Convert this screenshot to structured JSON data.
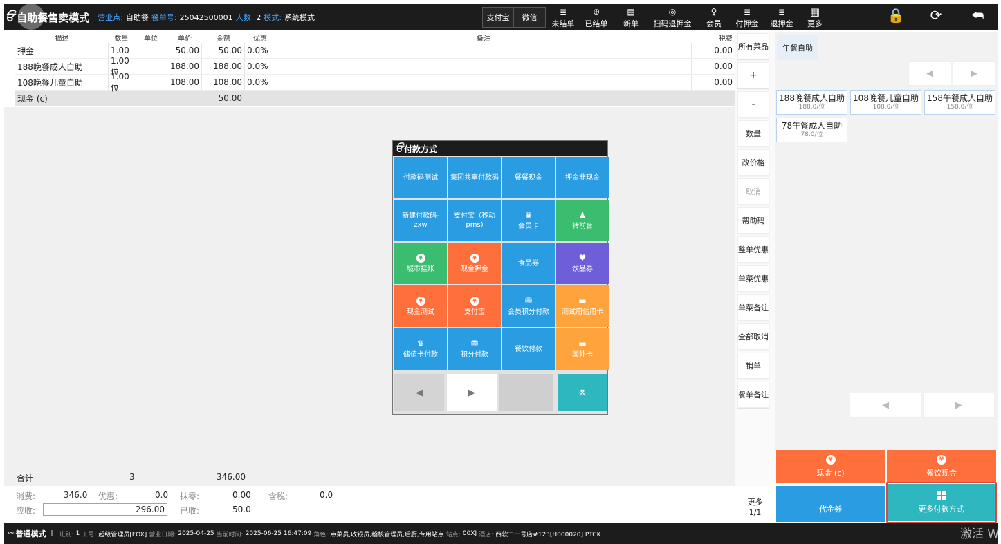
{
  "topbar": {
    "logo": "ਓਂ",
    "mode": "自助餐售卖模式",
    "outlet_label": "营业点:",
    "outlet": "自助餐",
    "order_label": "餐单号:",
    "order_no": "25042500001",
    "people_label": "人数:",
    "people": "2",
    "sysmode_label": "模式:",
    "sysmode": "系统模式",
    "pay_alipay": "支付宝",
    "pay_wechat": "微信",
    "buttons": [
      {
        "label": "未结单",
        "icon": "≣"
      },
      {
        "label": "已结单",
        "icon": "⊕"
      },
      {
        "label": "新单",
        "icon": "▤"
      },
      {
        "label": "扫码退押金",
        "icon": "◎"
      },
      {
        "label": "会员",
        "icon": "♀"
      },
      {
        "label": "付押金",
        "icon": "≣"
      },
      {
        "label": "退押金",
        "icon": "≣"
      },
      {
        "label": "更多",
        "icon": "▦"
      }
    ],
    "right_icons": [
      "lock-icon",
      "refresh-icon",
      "back-icon"
    ]
  },
  "table": {
    "headers": [
      "描述",
      "数量",
      "单位",
      "单价",
      "金额",
      "优惠",
      "备注",
      "税费"
    ],
    "rows": [
      {
        "name": "押金",
        "qty": "1.00",
        "unit": "",
        "price": "50.00",
        "amount": "50.00",
        "discount": "0.0%",
        "note": "",
        "tax": "0.00"
      },
      {
        "name": "188晚餐成人自助",
        "qty": "1.00位",
        "unit": "",
        "price": "188.00",
        "amount": "188.00",
        "discount": "0.0%",
        "note": "",
        "tax": "0.00"
      },
      {
        "name": "108晚餐儿童自助",
        "qty": "1.00位",
        "unit": "",
        "price": "108.00",
        "amount": "108.00",
        "discount": "0.0%",
        "note": "",
        "tax": "0.00"
      }
    ],
    "payment_row": {
      "name": "现金 (c)",
      "amount": "50.00"
    }
  },
  "totals": {
    "label": "合计",
    "count": "3",
    "amount": "346.00"
  },
  "summary": {
    "consume_label": "消费:",
    "consume": "346.0",
    "discount_label": "优惠:",
    "discount": "0.0",
    "rounding_label": "抹零:",
    "rounding": "0.00",
    "tax_label": "含税:",
    "tax": "0.0",
    "due_label": "应收:",
    "due": "296.00",
    "received_label": "已收:",
    "received": "50.0"
  },
  "functions": [
    "所有菜品",
    "+",
    "-",
    "数量",
    "改价格",
    "取消",
    "帮助码",
    "整单优惠",
    "单菜优惠",
    "单菜备注",
    "全部取消",
    "销单",
    "餐单备注"
  ],
  "more_page": {
    "label": "更多",
    "page": "1/1"
  },
  "dish": {
    "category": "午餐自助",
    "items": [
      {
        "name": "188晚餐成人自助",
        "price": "188.0/位"
      },
      {
        "name": "108晚餐儿童自助",
        "price": "108.0/位"
      },
      {
        "name": "158午餐成人自助",
        "price": "158.0/位"
      },
      {
        "name": "78午餐成人自助",
        "price": "78.0/位"
      }
    ]
  },
  "pay_tiles": [
    {
      "label": "现金 (c)",
      "color": "#ff6f3c"
    },
    {
      "label": "餐饮现金",
      "color": "#ff6f3c"
    },
    {
      "label": "代金券",
      "color": "#2a9de2"
    },
    {
      "label": "更多付款方式",
      "color": "#2fb7c0"
    }
  ],
  "modal": {
    "title": "付款方式",
    "methods": [
      {
        "label": "付款码测试",
        "color": "blue",
        "icon": ""
      },
      {
        "label": "集团共享付款码",
        "color": "blue",
        "icon": ""
      },
      {
        "label": "餐餐现金",
        "color": "blue",
        "icon": ""
      },
      {
        "label": "押金非现金",
        "color": "blue",
        "icon": ""
      },
      {
        "label": "新建付款码-zxw",
        "color": "blue",
        "icon": ""
      },
      {
        "label": "支付宝（移动pms)",
        "color": "blue",
        "icon": ""
      },
      {
        "label": "会员卡",
        "color": "blue",
        "icon": "♛"
      },
      {
        "label": "转前台",
        "color": "green",
        "icon": "♟"
      },
      {
        "label": "城市挂账",
        "color": "green",
        "icon": "¥"
      },
      {
        "label": "现金押金",
        "color": "orange",
        "icon": "¥"
      },
      {
        "label": "食品券",
        "color": "blue",
        "icon": ""
      },
      {
        "label": "饮品券",
        "color": "purple",
        "icon": "♥"
      },
      {
        "label": "现金测试",
        "color": "orange",
        "icon": "¥"
      },
      {
        "label": "支付宝",
        "color": "orange",
        "icon": "¥"
      },
      {
        "label": "会员积分付款",
        "color": "blue",
        "icon": "⛃"
      },
      {
        "label": "测试用信用卡",
        "color": "yellow",
        "icon": "▬"
      },
      {
        "label": "储值卡付款",
        "color": "blue",
        "icon": "♛"
      },
      {
        "label": "积分付款",
        "color": "blue",
        "icon": "⛃"
      },
      {
        "label": "餐饮付款",
        "color": "blue",
        "icon": ""
      },
      {
        "label": "国外卡",
        "color": "yellow",
        "icon": "▬"
      }
    ]
  },
  "status": {
    "mode": "普通模式",
    "shift_label": "班别:",
    "shift": "1",
    "staff_label": "工号:",
    "staff": "超级管理员[FOX]",
    "bizdate_label": "营业日期:",
    "bizdate": "2025-04-25",
    "time_label": "当前时间:",
    "time": "2025-06-25 16:47:09",
    "role_label": "角色:",
    "role": "点菜员,收银员,稽核管理员,后厨,专用站点",
    "station_label": "站点:",
    "station": "00XJ",
    "hotel_label": "酒店:",
    "hotel": "西软二十号店#123[H000020] PTCK"
  },
  "watermark": "激活 W"
}
